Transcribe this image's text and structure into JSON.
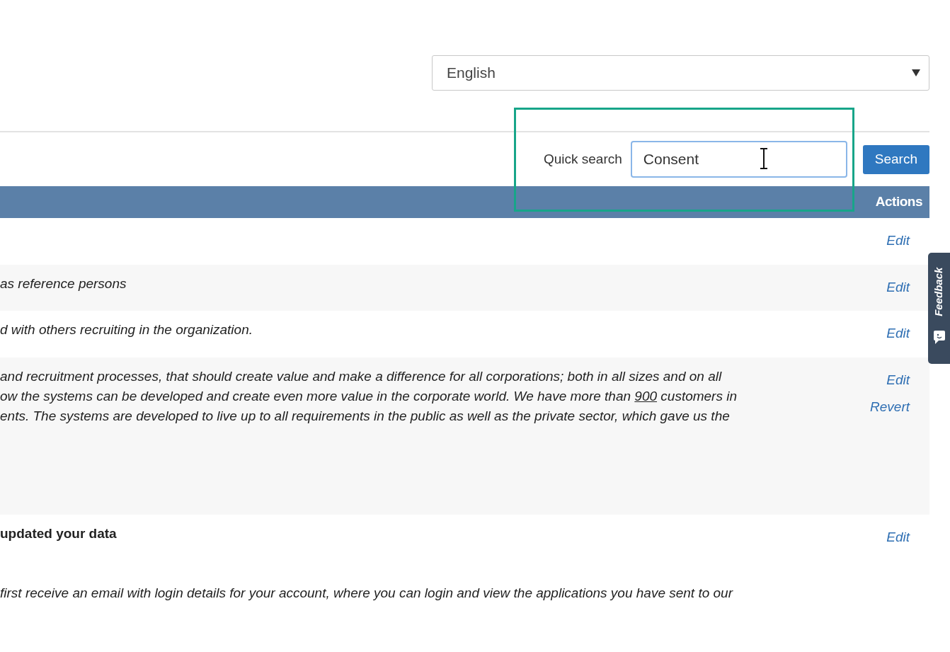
{
  "language_select": {
    "value": "English"
  },
  "quick_search": {
    "label": "Quick search",
    "value": "Consent",
    "button": "Search"
  },
  "table": {
    "columns": [
      {
        "label": "Actions"
      }
    ],
    "rows": [
      {
        "lines": [],
        "actions": [
          "Edit"
        ]
      },
      {
        "lines": [
          {
            "kind": "italic",
            "text": "as reference persons"
          }
        ],
        "actions": [
          "Edit"
        ]
      },
      {
        "lines": [
          {
            "kind": "italic",
            "text": "d with others recruiting in the organization."
          }
        ],
        "actions": [
          "Edit"
        ]
      },
      {
        "lines": [
          {
            "kind": "italic",
            "text": "and recruitment processes, that should create value and make a difference for all corporations; both in all sizes and on all"
          },
          {
            "kind": "italic",
            "parts": [
              {
                "text": "ow the systems can be developed and create even more value in the corporate world. We have more than",
                "underlined": false
              },
              {
                "text": "900",
                "underlined": true
              },
              {
                "text": "customers in",
                "underlined": false
              }
            ]
          },
          {
            "kind": "italic",
            "text": "ents. The systems are developed to live up to all requirements in the public as well as the private sector, which gave us the"
          }
        ],
        "actions": [
          "Edit",
          "Revert"
        ]
      },
      {
        "lines": [
          {
            "kind": "bold",
            "text": "updated your data"
          },
          {
            "kind": "italic",
            "text": "first receive an email with login details for your account, where you can login and view the applications you have sent to our"
          }
        ],
        "actions": [
          "Edit"
        ]
      }
    ]
  },
  "feedback_tab": {
    "label": "Feedback"
  }
}
